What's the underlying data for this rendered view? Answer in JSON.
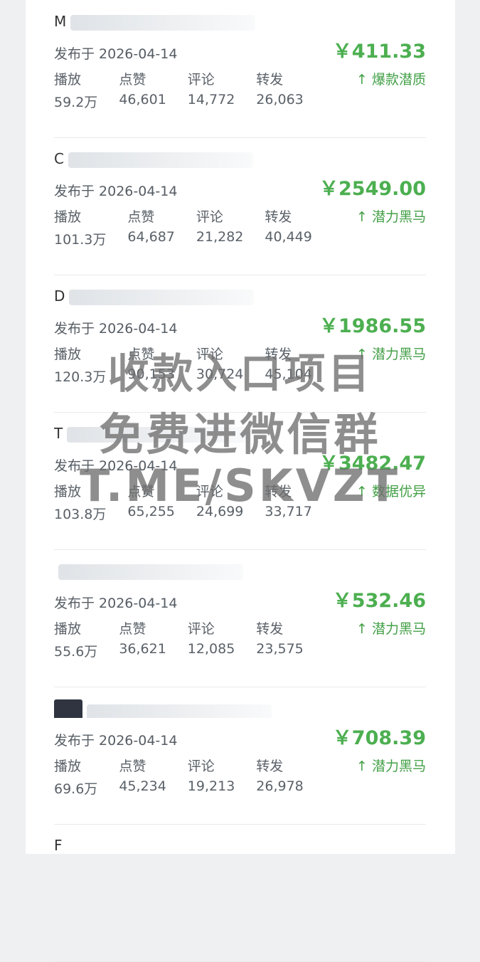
{
  "items": [
    {
      "title": "M",
      "date": "发布于 2026-04-14",
      "price": "￥411.33",
      "tag": "↑ 爆款潜质",
      "labels": [
        "播放",
        "点赞",
        "评论",
        "转发"
      ],
      "values": [
        "59.2万",
        "46,601",
        "14,772",
        "26,063"
      ]
    },
    {
      "title": "C",
      "date": "发布于 2026-04-14",
      "price": "￥2549.00",
      "tag": "↑ 潜力黑马",
      "labels": [
        "播放",
        "点赞",
        "评论",
        "转发"
      ],
      "values": [
        "101.3万",
        "64,687",
        "21,282",
        "40,449"
      ]
    },
    {
      "title": "D",
      "date": "发布于 2026-04-14",
      "price": "￥1986.55",
      "tag": "↑ 潜力黑马",
      "labels": [
        "播放",
        "点赞",
        "评论",
        "转发"
      ],
      "values": [
        "120.3万",
        "90,153",
        "30,724",
        "45,104"
      ]
    },
    {
      "title": "T",
      "date": "发布于 2026-04-14",
      "price": "￥3482.47",
      "tag": "↑ 数据优异",
      "labels": [
        "播放",
        "点赞",
        "评论",
        "转发"
      ],
      "values": [
        "103.8万",
        "65,255",
        "24,699",
        "33,717"
      ]
    },
    {
      "title": "",
      "date": "发布于 2026-04-14",
      "price": "￥532.46",
      "tag": "↑ 潜力黑马",
      "labels": [
        "播放",
        "点赞",
        "评论",
        "转发"
      ],
      "values": [
        "55.6万",
        "36,621",
        "12,085",
        "23,575"
      ]
    },
    {
      "title": "",
      "date": "发布于 2026-04-14",
      "price": "￥708.39",
      "tag": "↑ 潜力黑马",
      "labels": [
        "播放",
        "点赞",
        "评论",
        "转发"
      ],
      "values": [
        "69.6万",
        "45,234",
        "19,213",
        "26,978"
      ]
    },
    {
      "title": "F",
      "date": "",
      "price": "",
      "tag": "",
      "labels": [],
      "values": []
    }
  ],
  "watermark": {
    "line1": "收款入口项目",
    "line2": "免费进微信群",
    "line3": "T.ME/SKVZT"
  },
  "colors": {
    "price": "#4caf50",
    "tag": "#43a047",
    "text": "#5a6168"
  }
}
